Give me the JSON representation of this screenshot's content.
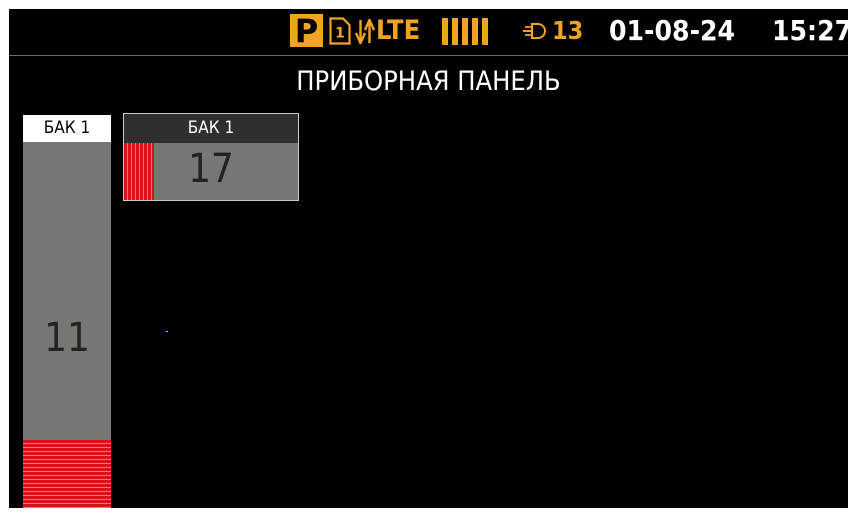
{
  "status_bar": {
    "mode_badge": "P",
    "sim_slot": "1",
    "network_type": "LTE",
    "signal_strength": {
      "bars": 5,
      "max_bars": 5
    },
    "connection_count": "13",
    "date": "01-08-24",
    "time": "15:27",
    "icons": [
      "park-mode-icon",
      "sim-card-icon",
      "data-transfer-arrows-icon",
      "signal-bars-icon",
      "plug-icon"
    ]
  },
  "page": {
    "title": "ПРИБОРНАЯ ПАНЕЛЬ"
  },
  "gauges": [
    {
      "label": "БАК 1",
      "value": "11",
      "fill_percent": 11,
      "orientation": "vertical"
    },
    {
      "label": "БАК 1",
      "value": "17",
      "fill_percent": 17,
      "orientation": "horizontal"
    }
  ],
  "colors": {
    "accent": "#f3a322",
    "background": "#000000",
    "gauge_body": "#777773",
    "gauge_fill": "#d6131a",
    "text": "#ffffff"
  }
}
